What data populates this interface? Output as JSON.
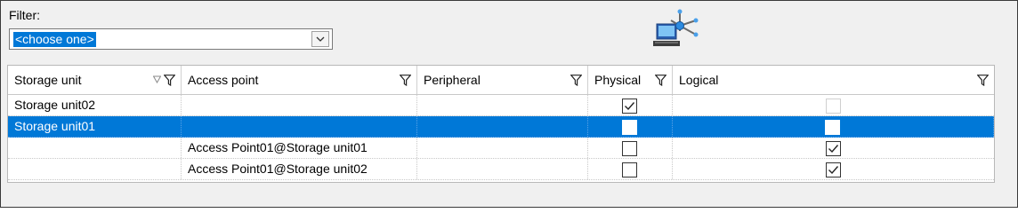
{
  "filter": {
    "label": "Filter:",
    "selected": "<choose one>"
  },
  "icons": {
    "header_icon": "network-computer-icon",
    "filter_icon": "funnel-icon",
    "sort_icon": "sort-triangle-icon",
    "dropdown_icon": "chevron-down-icon"
  },
  "colors": {
    "selection": "#0078d7",
    "header_bg": "#ffffff",
    "panel_bg": "#f0f0f0"
  },
  "columns": [
    "Storage unit",
    "Access point",
    "Peripheral",
    "Physical",
    "Logical"
  ],
  "rows": [
    {
      "storage_unit": "Storage unit02",
      "access_point": "",
      "peripheral": "",
      "physical": "checked",
      "logical": "disabled",
      "selected": false
    },
    {
      "storage_unit": "Storage unit01",
      "access_point": "",
      "peripheral": "",
      "physical": "unchecked",
      "logical": "unchecked",
      "selected": true
    },
    {
      "storage_unit": "",
      "access_point": "Access Point01@Storage unit01",
      "peripheral": "",
      "physical": "unchecked",
      "logical": "checked",
      "selected": false
    },
    {
      "storage_unit": "",
      "access_point": "Access Point01@Storage unit02",
      "peripheral": "",
      "physical": "unchecked",
      "logical": "checked",
      "selected": false
    }
  ]
}
